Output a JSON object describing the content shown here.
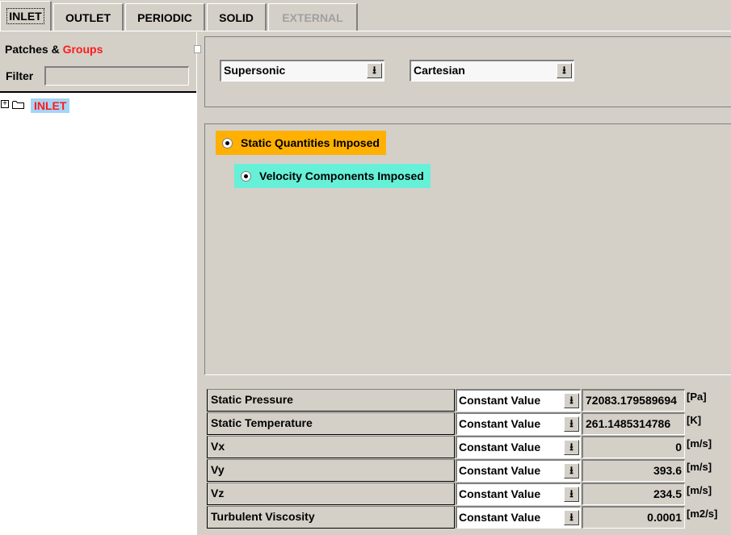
{
  "tabs": [
    {
      "label": "INLET",
      "state": "active"
    },
    {
      "label": "OUTLET",
      "state": "normal"
    },
    {
      "label": "PERIODIC",
      "state": "normal"
    },
    {
      "label": "SOLID",
      "state": "normal"
    },
    {
      "label": "EXTERNAL",
      "state": "disabled"
    }
  ],
  "left_panel": {
    "patches_label": "Patches &",
    "groups_label": "Groups",
    "filter_label": "Filter",
    "filter_value": "",
    "tree": [
      {
        "label": "INLET",
        "expand_glyph": "+",
        "icon": "folder-icon"
      }
    ]
  },
  "top_panel": {
    "type_combo": "Supersonic",
    "coord_combo": "Cartesian"
  },
  "options": {
    "static_imposed": "Static Quantities Imposed",
    "velocity_imposed": "Velocity Components Imposed",
    "static_color": "#ffb000",
    "velocity_color": "#66f0d8"
  },
  "table": {
    "rows": [
      {
        "label": "Static Pressure",
        "mode": "Constant Value",
        "value": "72083.179589694",
        "unit": "[Pa]"
      },
      {
        "label": "Static Temperature",
        "mode": "Constant Value",
        "value": "261.1485314786",
        "unit": "[K]"
      },
      {
        "label": "Vx",
        "mode": "Constant Value",
        "value": "0",
        "unit": "[m/s]"
      },
      {
        "label": "Vy",
        "mode": "Constant Value",
        "value": "393.6",
        "unit": "[m/s]"
      },
      {
        "label": "Vz",
        "mode": "Constant Value",
        "value": "234.5",
        "unit": "[m/s]"
      },
      {
        "label": "Turbulent Viscosity",
        "mode": "Constant Value",
        "value": "0.0001",
        "unit": "[m2/s]"
      }
    ]
  },
  "icons": {
    "dropdown": "⭳"
  }
}
